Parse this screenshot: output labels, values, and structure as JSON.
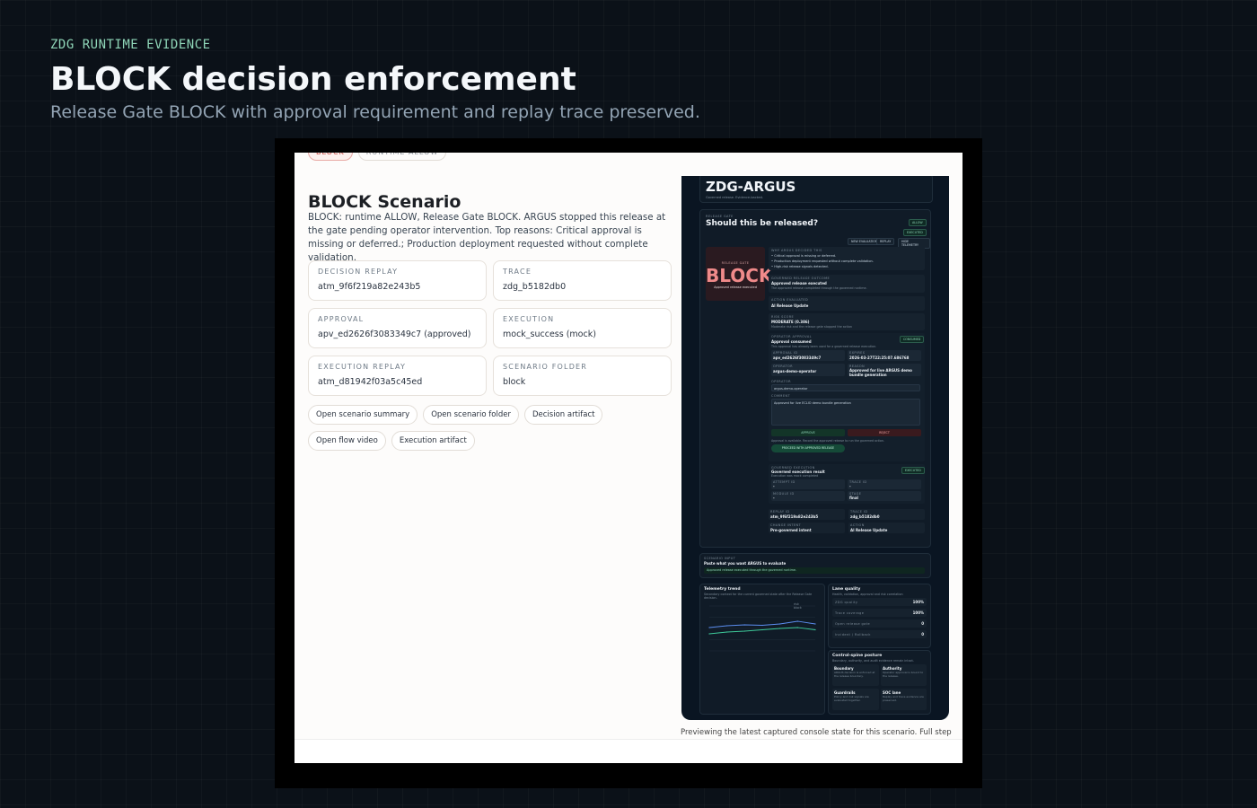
{
  "header": {
    "eyebrow": "ZDG RUNTIME EVIDENCE",
    "title": "BLOCK decision enforcement",
    "subtitle": "Release Gate BLOCK with approval requirement and replay trace preserved."
  },
  "scenario": {
    "chips": [
      "BLOCK",
      "RUNTIME ALLOW"
    ],
    "title": "BLOCK Scenario",
    "description": "BLOCK: runtime ALLOW, Release Gate BLOCK. ARGUS stopped this release at the gate pending operator intervention. Top reasons: Critical approval is missing or deferred.; Production deployment requested without complete validation.",
    "cards": [
      {
        "label": "DECISION REPLAY",
        "value": "atm_9f6f219a82e243b5"
      },
      {
        "label": "TRACE",
        "value": "zdg_b5182db0"
      },
      {
        "label": "APPROVAL",
        "value": "apv_ed2626f3083349c7 (approved)"
      },
      {
        "label": "EXECUTION",
        "value": "mock_success (mock)"
      },
      {
        "label": "EXECUTION REPLAY",
        "value": "atm_d81942f03a5c45ed"
      },
      {
        "label": "SCENARIO FOLDER",
        "value": "block"
      }
    ],
    "actions": [
      "Open scenario summary",
      "Open scenario folder",
      "Decision artifact",
      "Open flow video",
      "Execution artifact"
    ]
  },
  "console": {
    "brand": "ZDG-ARGUS",
    "brand_sub": "Governed release. Evidence-backed.",
    "question_label": "RELEASE GATE",
    "question": "Should this be released?",
    "status_allow": "ALLOW",
    "status_executed": "EXECUTED",
    "buttons": [
      "NEW EVALUATION",
      "REPLAY",
      "HIDE TELEMETRY"
    ],
    "verdict_label": "RELEASE GATE",
    "verdict": "BLOCK",
    "verdict_note": "Approved release executed",
    "reasons_label": "WHY ARGUS DECIDED THIS",
    "reasons": [
      "Critical approval is missing or deferred.",
      "Production deployment requested without complete validation.",
      "High-risk release signals detected."
    ],
    "outcome_label": "GOVERNED RELEASE OUTCOME",
    "outcome_title": "Approved release executed",
    "outcome_note": "The approved release completed through the governed runtime.",
    "action_label": "ACTION EVALUATED",
    "action": "AI Release Update",
    "risk_label": "RISK SCORE",
    "risk": "MODERATE (0.386)",
    "risk_note": "Moderate risk and the release gate stopped the action",
    "approval_label": "OPERATOR APPROVAL",
    "approval_title": "Approval consumed",
    "approval_badge": "CONSUMED",
    "approval_note": "This approval has already been used for a governed release execution.",
    "approval_fields": [
      {
        "label": "APPROVAL ID",
        "value": "apv_ed2626f3083349c7"
      },
      {
        "label": "EXPIRES",
        "value": "2026-03-27T22:25:07.686768"
      },
      {
        "label": "OPERATOR",
        "value": "argus-demo-operator"
      },
      {
        "label": "REASON",
        "value": "Approved for live ARGUS demo bundle generation"
      }
    ],
    "operator_label": "OPERATOR",
    "operator_value": "argus-demo-operator",
    "comment_label": "COMMENT",
    "comment_value": "Approved for live ECLIO demo bundle generation",
    "approve": "APPROVE",
    "reject": "REJECT",
    "approve_note": "Approval is available. Record the approved release to run the governed action.",
    "proceed": "PROCEED WITH APPROVED RELEASE",
    "exec_label": "GOVERNED EXECUTION",
    "exec_title": "Governed execution result",
    "exec_badge": "EXECUTED",
    "exec_note": "Execution was mock completed",
    "exec_fields": [
      {
        "label": "ATTEMPT ID",
        "value": "-"
      },
      {
        "label": "TRACE ID",
        "value": "-"
      },
      {
        "label": "MODULE ID",
        "value": "-"
      },
      {
        "label": "STAGE",
        "value": "final"
      }
    ],
    "replay_fields": [
      {
        "label": "REPLAY ID",
        "value": "atm_9f6f219a82e243b5"
      },
      {
        "label": "TRACE ID",
        "value": "zdg_b5182db0"
      },
      {
        "label": "CHANGE INTENT",
        "value": "Pre-governed intent"
      },
      {
        "label": "ACTION",
        "value": "AI Release Update"
      }
    ],
    "prompt_label": "SCENARIO INPUT",
    "prompt_title": "Paste what you want ARGUS to evaluate",
    "prompt_value": "Approved release executed through the governed runtime.",
    "telemetry_title": "Telemetry trend",
    "telemetry_sub": "Secondary context for the current governed state after the Release Gate decision.",
    "legend": [
      "risk",
      "block"
    ],
    "lane_title": "Lane quality",
    "lane_sub": "Health, validation, approval and risk correlation",
    "lanes": [
      {
        "label": "ZDG quality",
        "value": "100%"
      },
      {
        "label": "Trace coverage",
        "value": "100%"
      },
      {
        "label": "Open release gate",
        "value": "0"
      },
      {
        "label": "Incident / Rollback",
        "value": "0"
      }
    ],
    "spine_title": "Control-spine posture",
    "spine_sub": "Boundary, authority, and audit evidence remain intact.",
    "spine_cards": [
      {
        "title": "Boundary",
        "body": "ARGUS decision is enforced at the release boundary."
      },
      {
        "title": "Authority",
        "body": "Operator approval is bound to the release."
      },
      {
        "title": "Guardrails",
        "body": "Policy and risk signals are evaluated together."
      },
      {
        "title": "SOC lane",
        "body": "Replay and trace evidence are preserved."
      }
    ]
  },
  "chart_data": {
    "type": "line",
    "title": "Telemetry trend",
    "x": [
      1,
      2,
      3,
      4,
      5,
      6,
      7
    ],
    "series": [
      {
        "name": "risk",
        "values": [
          0.52,
          0.56,
          0.58,
          0.57,
          0.6,
          0.66,
          0.6
        ],
        "color": "#5b8def"
      },
      {
        "name": "block",
        "values": [
          0.38,
          0.42,
          0.44,
          0.47,
          0.5,
          0.52,
          0.47
        ],
        "color": "#3ec99a"
      }
    ],
    "ylim": [
      0,
      1
    ]
  },
  "caption": "Previewing the latest captured console state for this scenario. Full step"
}
